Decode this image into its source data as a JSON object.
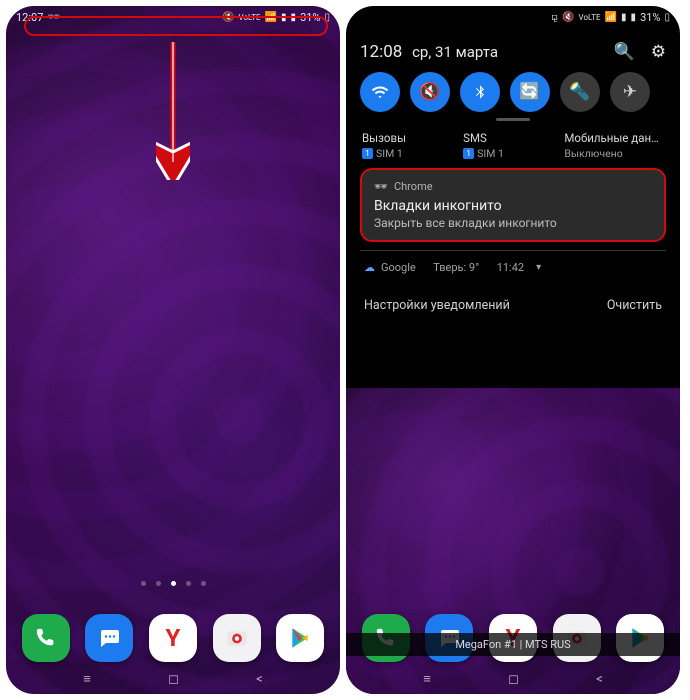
{
  "left": {
    "status": {
      "time": "12:07",
      "battery": "31%"
    }
  },
  "right": {
    "status": {
      "battery": "31%"
    },
    "shade": {
      "time": "12:08",
      "date": "ср, 31 марта",
      "tiles": {
        "calls": {
          "label": "Вызовы",
          "sim": "SIM 1"
        },
        "sms": {
          "label": "SMS",
          "sim": "SIM 1"
        },
        "data": {
          "label": "Мобильные дан…",
          "state": "Выключено"
        }
      },
      "chrome": {
        "app": "Chrome",
        "title": "Вкладки инкогнито",
        "sub": "Закрыть все вкладки инкогнито"
      },
      "weather": {
        "app": "Google",
        "text": "Тверь: 9°",
        "time": "11:42"
      },
      "actions": {
        "settings": "Настройки уведомлений",
        "clear": "Очистить"
      }
    },
    "carrier": "MegaFon #1 | MTS RUS"
  }
}
